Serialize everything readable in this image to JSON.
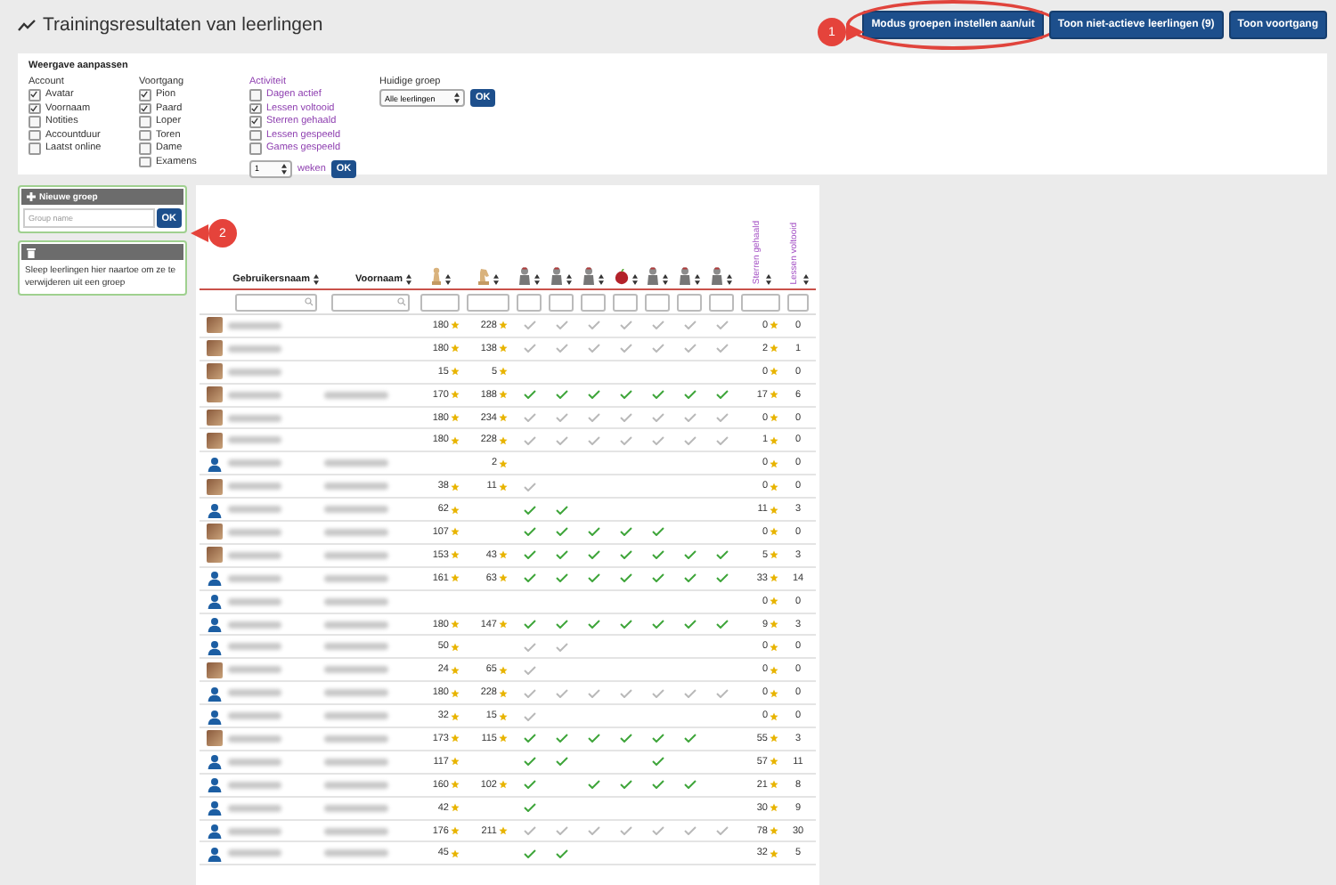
{
  "header": {
    "title": "Trainingsresultaten van leerlingen",
    "buttons": [
      {
        "label": "Modus groepen instellen aan/uit",
        "highlighted": true
      },
      {
        "label": "Toon niet-actieve leerlingen (9)",
        "highlighted": false
      },
      {
        "label": "Toon voortgang",
        "highlighted": false
      }
    ]
  },
  "annotations": [
    {
      "label": "1"
    },
    {
      "label": "2"
    }
  ],
  "settings": {
    "title": "Weergave aanpassen",
    "groups": [
      {
        "title": "Account",
        "kind": "plain",
        "options": [
          {
            "label": "Avatar",
            "checked": true
          },
          {
            "label": "Voornaam",
            "checked": true
          },
          {
            "label": "Notities",
            "checked": false
          },
          {
            "label": "Accountduur",
            "checked": false
          },
          {
            "label": "Laatst online",
            "checked": false
          }
        ]
      },
      {
        "title": "Voortgang",
        "kind": "plain",
        "options": [
          {
            "label": "Pion",
            "checked": true
          },
          {
            "label": "Paard",
            "checked": true
          },
          {
            "label": "Loper",
            "checked": false
          },
          {
            "label": "Toren",
            "checked": false
          },
          {
            "label": "Dame",
            "checked": false
          },
          {
            "label": "Examens",
            "checked": false
          }
        ]
      },
      {
        "title": "Activiteit",
        "kind": "period",
        "options": [
          {
            "label": "Dagen actief",
            "checked": false
          },
          {
            "label": "Lessen voltooid",
            "checked": true
          },
          {
            "label": "Sterren gehaald",
            "checked": true
          },
          {
            "label": "Lessen gespeeld",
            "checked": false
          },
          {
            "label": "Games gespeeld",
            "checked": false
          }
        ]
      }
    ],
    "weeks": {
      "value": "1",
      "label": "weken",
      "button": "OK"
    },
    "current_group": {
      "label": "Huidige groep",
      "value": "Alle leerlingen",
      "button": "OK"
    }
  },
  "groups_panel": {
    "new_group": {
      "title": "Nieuwe groep",
      "placeholder": "Group name",
      "button": "OK"
    },
    "trash": {
      "text": "Sleep leerlingen hier naartoe om ze te verwijderen uit een groep"
    }
  },
  "table": {
    "columns": [
      {
        "kind": "text",
        "label": "Gebruikersnaam"
      },
      {
        "kind": "text",
        "label": "Voornaam"
      },
      {
        "kind": "icon"
      },
      {
        "kind": "icon"
      },
      {
        "kind": "icon"
      },
      {
        "kind": "icon"
      },
      {
        "kind": "icon"
      },
      {
        "kind": "icon"
      },
      {
        "kind": "icon"
      },
      {
        "kind": "icon"
      },
      {
        "kind": "icon"
      },
      {
        "kind": "vertical",
        "label": "Sterren gehaald"
      },
      {
        "kind": "vertical",
        "label": "Lessen voltooid"
      }
    ],
    "rows": [
      {
        "has_photo": true,
        "first_name_shown": false,
        "pawn": "180",
        "knight": "228",
        "stars_earned": "0",
        "lessons": "0",
        "checks": [
          {
            "kind": "seen"
          },
          {
            "kind": "seen"
          },
          {
            "kind": "seen"
          },
          {
            "kind": "seen"
          },
          {
            "kind": "seen"
          },
          {
            "kind": "seen"
          },
          {
            "kind": "seen"
          }
        ]
      },
      {
        "has_photo": true,
        "first_name_shown": false,
        "pawn": "180",
        "knight": "138",
        "stars_earned": "2",
        "lessons": "1",
        "checks": [
          {
            "kind": "seen"
          },
          {
            "kind": "seen"
          },
          {
            "kind": "seen"
          },
          {
            "kind": "seen"
          },
          {
            "kind": "seen"
          },
          {
            "kind": "seen"
          },
          {
            "kind": "seen"
          }
        ]
      },
      {
        "has_photo": true,
        "first_name_shown": false,
        "pawn": "15",
        "knight": "5",
        "stars_earned": "0",
        "lessons": "0",
        "checks": [
          {
            "kind": "empty"
          },
          {
            "kind": "empty"
          },
          {
            "kind": "empty"
          },
          {
            "kind": "empty"
          },
          {
            "kind": "empty"
          },
          {
            "kind": "empty"
          },
          {
            "kind": "empty"
          }
        ]
      },
      {
        "has_photo": true,
        "first_name_shown": true,
        "pawn": "170",
        "knight": "188",
        "stars_earned": "17",
        "lessons": "6",
        "checks": [
          {
            "kind": "done"
          },
          {
            "kind": "done"
          },
          {
            "kind": "done"
          },
          {
            "kind": "done"
          },
          {
            "kind": "done"
          },
          {
            "kind": "done"
          },
          {
            "kind": "done"
          }
        ]
      },
      {
        "has_photo": true,
        "first_name_shown": false,
        "pawn": "180",
        "knight": "234",
        "stars_earned": "0",
        "lessons": "0",
        "checks": [
          {
            "kind": "seen"
          },
          {
            "kind": "seen"
          },
          {
            "kind": "seen"
          },
          {
            "kind": "seen"
          },
          {
            "kind": "seen"
          },
          {
            "kind": "seen"
          },
          {
            "kind": "seen"
          }
        ]
      },
      {
        "has_photo": true,
        "first_name_shown": false,
        "pawn": "180",
        "knight": "228",
        "stars_earned": "1",
        "lessons": "0",
        "checks": [
          {
            "kind": "seen"
          },
          {
            "kind": "seen"
          },
          {
            "kind": "seen"
          },
          {
            "kind": "seen"
          },
          {
            "kind": "seen"
          },
          {
            "kind": "seen"
          },
          {
            "kind": "seen"
          }
        ]
      },
      {
        "has_photo": false,
        "first_name_shown": true,
        "knight": "2",
        "stars_earned": "0",
        "lessons": "0",
        "checks": [
          {
            "kind": "empty"
          },
          {
            "kind": "empty"
          },
          {
            "kind": "empty"
          },
          {
            "kind": "empty"
          },
          {
            "kind": "empty"
          },
          {
            "kind": "empty"
          },
          {
            "kind": "empty"
          }
        ]
      },
      {
        "has_photo": true,
        "first_name_shown": true,
        "pawn": "38",
        "knight": "11",
        "stars_earned": "0",
        "lessons": "0",
        "checks": [
          {
            "kind": "seen"
          },
          {
            "kind": "empty"
          },
          {
            "kind": "empty"
          },
          {
            "kind": "empty"
          },
          {
            "kind": "empty"
          },
          {
            "kind": "empty"
          },
          {
            "kind": "empty"
          }
        ]
      },
      {
        "has_photo": false,
        "first_name_shown": true,
        "pawn": "62",
        "stars_earned": "11",
        "lessons": "3",
        "checks": [
          {
            "kind": "done"
          },
          {
            "kind": "done"
          },
          {
            "kind": "empty"
          },
          {
            "kind": "empty"
          },
          {
            "kind": "empty"
          },
          {
            "kind": "empty"
          },
          {
            "kind": "empty"
          }
        ]
      },
      {
        "has_photo": true,
        "first_name_shown": true,
        "pawn": "107",
        "stars_earned": "0",
        "lessons": "0",
        "checks": [
          {
            "kind": "done"
          },
          {
            "kind": "done"
          },
          {
            "kind": "done"
          },
          {
            "kind": "done"
          },
          {
            "kind": "done"
          },
          {
            "kind": "empty"
          },
          {
            "kind": "empty"
          }
        ]
      },
      {
        "has_photo": true,
        "first_name_shown": true,
        "pawn": "153",
        "knight": "43",
        "stars_earned": "5",
        "lessons": "3",
        "checks": [
          {
            "kind": "done"
          },
          {
            "kind": "done"
          },
          {
            "kind": "done"
          },
          {
            "kind": "done"
          },
          {
            "kind": "done"
          },
          {
            "kind": "done"
          },
          {
            "kind": "done"
          }
        ]
      },
      {
        "has_photo": false,
        "first_name_shown": true,
        "pawn": "161",
        "knight": "63",
        "stars_earned": "33",
        "lessons": "14",
        "checks": [
          {
            "kind": "done"
          },
          {
            "kind": "done"
          },
          {
            "kind": "done"
          },
          {
            "kind": "done"
          },
          {
            "kind": "done"
          },
          {
            "kind": "done"
          },
          {
            "kind": "done"
          }
        ]
      },
      {
        "has_photo": false,
        "first_name_shown": true,
        "stars_earned": "0",
        "lessons": "0",
        "checks": [
          {
            "kind": "empty"
          },
          {
            "kind": "empty"
          },
          {
            "kind": "empty"
          },
          {
            "kind": "empty"
          },
          {
            "kind": "empty"
          },
          {
            "kind": "empty"
          },
          {
            "kind": "empty"
          }
        ]
      },
      {
        "has_photo": false,
        "first_name_shown": true,
        "pawn": "180",
        "knight": "147",
        "stars_earned": "9",
        "lessons": "3",
        "checks": [
          {
            "kind": "done"
          },
          {
            "kind": "done"
          },
          {
            "kind": "done"
          },
          {
            "kind": "done"
          },
          {
            "kind": "done"
          },
          {
            "kind": "done"
          },
          {
            "kind": "done"
          }
        ]
      },
      {
        "has_photo": false,
        "first_name_shown": true,
        "pawn": "50",
        "stars_earned": "0",
        "lessons": "0",
        "checks": [
          {
            "kind": "seen"
          },
          {
            "kind": "seen"
          },
          {
            "kind": "empty"
          },
          {
            "kind": "empty"
          },
          {
            "kind": "empty"
          },
          {
            "kind": "empty"
          },
          {
            "kind": "empty"
          }
        ]
      },
      {
        "has_photo": true,
        "first_name_shown": true,
        "pawn": "24",
        "knight": "65",
        "stars_earned": "0",
        "lessons": "0",
        "checks": [
          {
            "kind": "seen"
          },
          {
            "kind": "empty"
          },
          {
            "kind": "empty"
          },
          {
            "kind": "empty"
          },
          {
            "kind": "empty"
          },
          {
            "kind": "empty"
          },
          {
            "kind": "empty"
          }
        ]
      },
      {
        "has_photo": false,
        "first_name_shown": true,
        "pawn": "180",
        "knight": "228",
        "stars_earned": "0",
        "lessons": "0",
        "checks": [
          {
            "kind": "seen"
          },
          {
            "kind": "seen"
          },
          {
            "kind": "seen"
          },
          {
            "kind": "seen"
          },
          {
            "kind": "seen"
          },
          {
            "kind": "seen"
          },
          {
            "kind": "seen"
          }
        ]
      },
      {
        "has_photo": false,
        "first_name_shown": true,
        "pawn": "32",
        "knight": "15",
        "stars_earned": "0",
        "lessons": "0",
        "checks": [
          {
            "kind": "seen"
          },
          {
            "kind": "empty"
          },
          {
            "kind": "empty"
          },
          {
            "kind": "empty"
          },
          {
            "kind": "empty"
          },
          {
            "kind": "empty"
          },
          {
            "kind": "empty"
          }
        ]
      },
      {
        "has_photo": true,
        "first_name_shown": true,
        "pawn": "173",
        "knight": "115",
        "stars_earned": "55",
        "lessons": "3",
        "checks": [
          {
            "kind": "done"
          },
          {
            "kind": "done"
          },
          {
            "kind": "done"
          },
          {
            "kind": "done"
          },
          {
            "kind": "done"
          },
          {
            "kind": "done"
          },
          {
            "kind": "empty"
          }
        ]
      },
      {
        "has_photo": false,
        "first_name_shown": true,
        "pawn": "117",
        "stars_earned": "57",
        "lessons": "11",
        "checks": [
          {
            "kind": "done"
          },
          {
            "kind": "done"
          },
          {
            "kind": "empty"
          },
          {
            "kind": "empty"
          },
          {
            "kind": "done"
          },
          {
            "kind": "empty"
          },
          {
            "kind": "empty"
          }
        ]
      },
      {
        "has_photo": false,
        "first_name_shown": true,
        "pawn": "160",
        "knight": "102",
        "stars_earned": "21",
        "lessons": "8",
        "checks": [
          {
            "kind": "done"
          },
          {
            "kind": "empty"
          },
          {
            "kind": "done"
          },
          {
            "kind": "done"
          },
          {
            "kind": "done"
          },
          {
            "kind": "done"
          },
          {
            "kind": "empty"
          }
        ]
      },
      {
        "has_photo": false,
        "first_name_shown": true,
        "pawn": "42",
        "stars_earned": "30",
        "lessons": "9",
        "checks": [
          {
            "kind": "done"
          },
          {
            "kind": "empty"
          },
          {
            "kind": "empty"
          },
          {
            "kind": "empty"
          },
          {
            "kind": "empty"
          },
          {
            "kind": "empty"
          },
          {
            "kind": "empty"
          }
        ]
      },
      {
        "has_photo": false,
        "first_name_shown": true,
        "pawn": "176",
        "knight": "211",
        "stars_earned": "78",
        "lessons": "30",
        "checks": [
          {
            "kind": "seen"
          },
          {
            "kind": "seen"
          },
          {
            "kind": "seen"
          },
          {
            "kind": "seen"
          },
          {
            "kind": "seen"
          },
          {
            "kind": "seen"
          },
          {
            "kind": "seen"
          }
        ]
      },
      {
        "has_photo": false,
        "first_name_shown": true,
        "pawn": "45",
        "stars_earned": "32",
        "lessons": "5",
        "checks": [
          {
            "kind": "done"
          },
          {
            "kind": "done"
          },
          {
            "kind": "empty"
          },
          {
            "kind": "empty"
          },
          {
            "kind": "empty"
          },
          {
            "kind": "empty"
          },
          {
            "kind": "empty"
          }
        ]
      }
    ]
  }
}
